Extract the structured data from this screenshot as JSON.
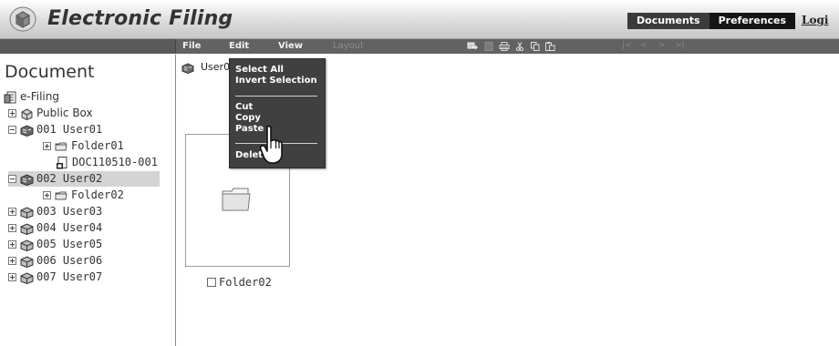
{
  "header": {
    "title": "Electronic Filing",
    "logo_icon": "cube-logo-icon",
    "tabs": [
      {
        "label": "Documents"
      },
      {
        "label": "Preferences"
      }
    ],
    "login_label": "Logi"
  },
  "menubar": {
    "items": [
      {
        "label": "File"
      },
      {
        "label": "Edit"
      },
      {
        "label": "View"
      },
      {
        "label": "Layout"
      }
    ],
    "toolbar_icons": [
      "move-icon",
      "blank-doc-icon",
      "print-icon",
      "cut-icon",
      "copy-icon",
      "paste-icon"
    ],
    "nav_icons": [
      "first-page-icon",
      "prev-page-icon",
      "next-page-icon",
      "last-page-icon"
    ]
  },
  "sidebar": {
    "heading": "Document",
    "tree": [
      {
        "label": "e-Filing",
        "icon": "efiling-icon"
      },
      {
        "label": "Public Box",
        "icon": "box-icon"
      },
      {
        "label": "001 User01",
        "icon": "user-box-icon"
      },
      {
        "label": "Folder01",
        "icon": "folder-icon"
      },
      {
        "label": "DOC110510-001",
        "icon": "document-icon"
      },
      {
        "label": "002 User02",
        "icon": "user-box-icon",
        "selected": true
      },
      {
        "label": "Folder02",
        "icon": "folder-icon"
      },
      {
        "label": "003 User03",
        "icon": "user-box-icon"
      },
      {
        "label": "004 User04",
        "icon": "user-box-icon"
      },
      {
        "label": "005 User05",
        "icon": "user-box-icon"
      },
      {
        "label": "006 User06",
        "icon": "user-box-icon"
      },
      {
        "label": "007 User07",
        "icon": "user-box-icon"
      }
    ]
  },
  "main": {
    "path_label": "User0",
    "items": [
      {
        "label": "Folder02",
        "icon": "folder-icon",
        "checked": false
      }
    ]
  },
  "edit_menu": {
    "items": [
      {
        "label": "Select All"
      },
      {
        "label": "Invert Selection"
      },
      {
        "label": "Cut"
      },
      {
        "label": "Copy"
      },
      {
        "label": "Paste"
      },
      {
        "label": "Delete"
      }
    ]
  }
}
